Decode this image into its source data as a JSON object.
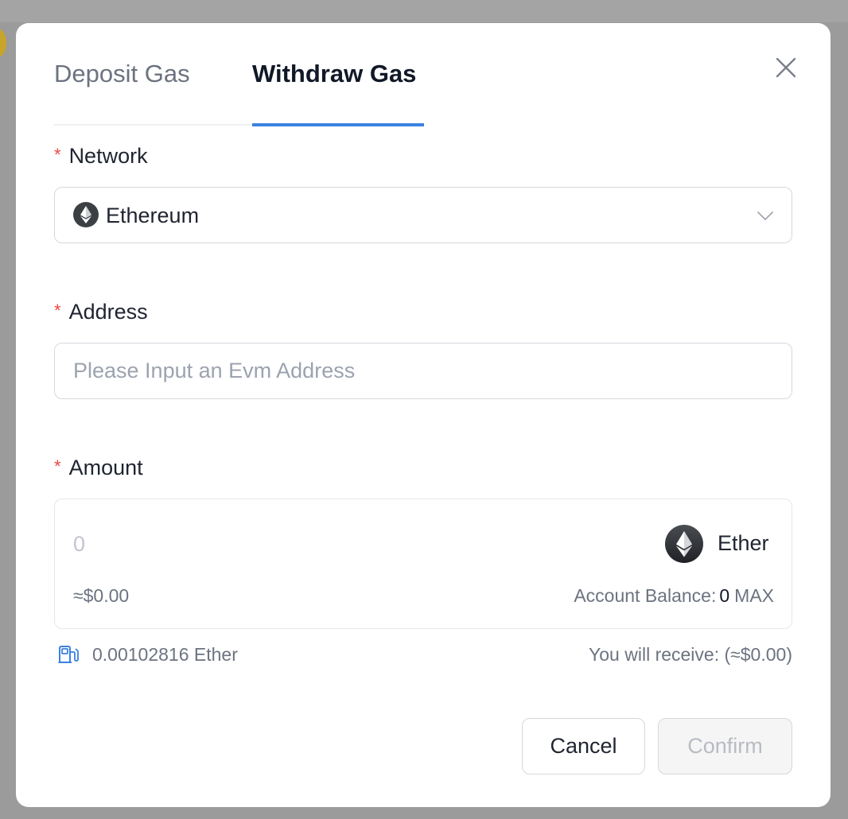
{
  "modal": {
    "tabs": [
      {
        "label": "Deposit Gas",
        "active": false
      },
      {
        "label": "Withdraw Gas",
        "active": true
      }
    ],
    "close_icon": "close-icon",
    "accent_color": "#3b82e0",
    "required_mark": "*"
  },
  "form": {
    "network": {
      "label": "Network",
      "value": "Ethereum",
      "icon": "ethereum-icon"
    },
    "address": {
      "label": "Address",
      "value": "",
      "placeholder": "Please Input an Evm Address"
    },
    "amount": {
      "label": "Amount",
      "value": "",
      "placeholder": "0",
      "token": "Ether",
      "usd_value": "≈$0.00",
      "balance_label": "Account Balance:",
      "balance_value": "0",
      "max_label": "MAX"
    },
    "gas_fee": "0.00102816 Ether",
    "receive": "You will receive: (≈$0.00)"
  },
  "actions": {
    "cancel_label": "Cancel",
    "confirm_label": "Confirm"
  }
}
